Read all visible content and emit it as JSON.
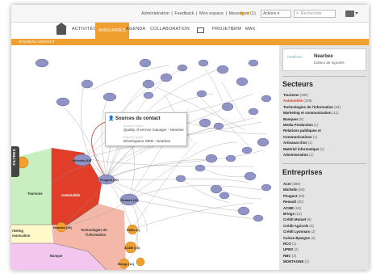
{
  "topbar": {
    "links": [
      "Administration",
      "Feedback",
      "Mon espace",
      "Messages (1)"
    ],
    "select_value": "Actions",
    "search_placeholder": "Rechercher"
  },
  "nav": {
    "items": [
      "ACTIVITÉS",
      "ANNUAIRES",
      "AGENDA",
      "COLLABORATION",
      "PROJETS",
      "CRM",
      "MAX"
    ],
    "active_index": 1
  },
  "subnav": {
    "label": "NOUVEAU CONTACT"
  },
  "filters_tab": {
    "label": "FILTRES"
  },
  "popup": {
    "title": "Sources du contact",
    "entries": [
      {
        "name": "Anatole Namo",
        "role": "Quality of service manager - Nearbee"
      },
      {
        "name": "Etienne Navo",
        "role": "Développeur WEB - Nearbee"
      }
    ]
  },
  "graph": {
    "sector_labels": [
      "Tourisme",
      "Automobile",
      "rketing\nmunication",
      "Technologie de\nl'information",
      "Banque"
    ],
    "node_labels": [
      "Michelin (60)",
      "Peugeot (20)",
      "Renault (20)",
      "Nearbee (50)",
      "PMEs (1)",
      "ACME (15)",
      "Briogs (12)"
    ]
  },
  "sidebar": {
    "company": {
      "logo": "nearbee",
      "name": "Nearbee",
      "subtitle": "Editeur de logiciels"
    },
    "sectors_title": "Secteurs",
    "sectors": [
      {
        "name": "Tourisme",
        "count": "(380)"
      },
      {
        "name": "Automobile",
        "count": "(100)"
      },
      {
        "name": "Technologies de l'information",
        "count": "(34)"
      },
      {
        "name": "Marketing et communication",
        "count": "(12)"
      },
      {
        "name": "Banques",
        "count": "(8)"
      },
      {
        "name": "Media Production",
        "count": "(1)"
      },
      {
        "name": "Relations publiques et",
        "count": ""
      },
      {
        "name": "Communications",
        "count": "(1)"
      },
      {
        "name": "Artisanat d'art",
        "count": "(1)"
      },
      {
        "name": "Matériel informatique",
        "count": "(1)"
      },
      {
        "name": "Administration",
        "count": "(1)"
      }
    ],
    "highlighted_sector_index": 1,
    "companies_title": "Entreprises",
    "companies": [
      {
        "name": "Acer",
        "count": "(380)"
      },
      {
        "name": "Michelin",
        "count": "(60)"
      },
      {
        "name": "Peugeot",
        "count": "(20)"
      },
      {
        "name": "Renault",
        "count": "(20)"
      },
      {
        "name": "ACME",
        "count": "(15)"
      },
      {
        "name": "Briogs",
        "count": "(12)"
      },
      {
        "name": "Crédit Mutuel",
        "count": "(8)"
      },
      {
        "name": "Crédit Agricole",
        "count": "(3)"
      },
      {
        "name": "Crédit Lyonnais",
        "count": "(2)"
      },
      {
        "name": "Caisse Épargne",
        "count": "(2)"
      },
      {
        "name": "RCO",
        "count": "(1)"
      },
      {
        "name": "UPBS",
        "count": "(2)"
      },
      {
        "name": "RBC",
        "count": "(2)"
      },
      {
        "name": "MONTAGNE",
        "count": "(1)"
      }
    ]
  },
  "colors": {
    "accent": "#f0a030",
    "sector_tourisme": "#c9eec0",
    "sector_automobile": "#e03e28",
    "sector_technologie": "#f3b8a8",
    "sector_banque": "#f2c6ee",
    "sector_marketing": "#fff8c8",
    "node": "#8f94c4",
    "node_orange": "#f0a030"
  }
}
